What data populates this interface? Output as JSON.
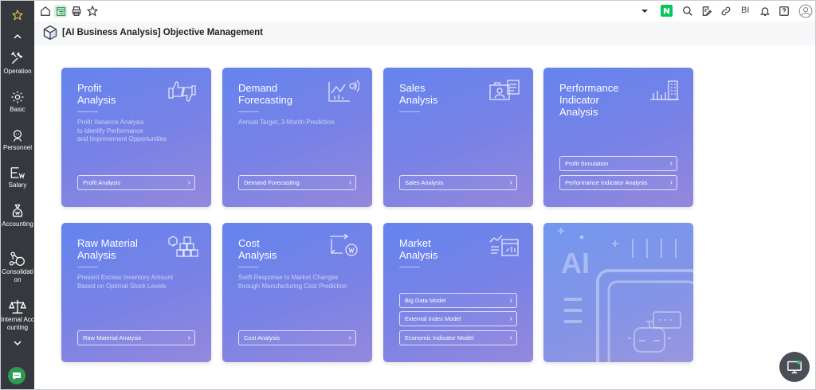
{
  "sidebar": {
    "items": [
      {
        "label": "Operation",
        "icon": "tools-icon"
      },
      {
        "label": "Basic",
        "icon": "gear-icon"
      },
      {
        "label": "Personnel",
        "icon": "person-icon"
      },
      {
        "label": "Salary",
        "icon": "salary-icon"
      },
      {
        "label": "Accounting",
        "icon": "money-bag-icon"
      },
      {
        "label": "Consolidation",
        "icon": "network-icon"
      },
      {
        "label": "Internal Accounting",
        "icon": "scale-icon"
      }
    ]
  },
  "toolbar": {
    "bi_label": "BI"
  },
  "page": {
    "title": "[AI Business Analysis] Objective Management"
  },
  "cards": {
    "profit": {
      "title": "Profit\nAnalysis",
      "desc": "Profit Variance Analysis\nto Identify Performance\nand Improvement Opportunities",
      "buttons": [
        "Profit Analysis"
      ]
    },
    "demand": {
      "title": "Demand\nForecasting",
      "desc": "Annual Target, 3-Month Prediction",
      "buttons": [
        "Demand Forecasting"
      ]
    },
    "sales": {
      "title": "Sales\nAnalysis",
      "desc": "",
      "buttons": [
        "Sales Analysis"
      ]
    },
    "performance": {
      "title": "Performance\nIndicator\nAnalysis",
      "desc": "",
      "buttons": [
        "Profit Simulation",
        "Performance Indicator Analysis"
      ]
    },
    "raw": {
      "title": "Raw Material\nAnalysis",
      "desc": "Present Excess Inventory Amount\nBased on Optimal Stock Levels",
      "buttons": [
        "Raw Material Analysis"
      ]
    },
    "cost": {
      "title": "Cost\nAnalysis",
      "desc": "Swift Response to Market Changes\nthrough Manufacturing Cost Prediction",
      "buttons": [
        "Cost Analysis"
      ]
    },
    "market": {
      "title": "Market\nAnalysis",
      "desc": "",
      "buttons": [
        "Big Data Model",
        "External Index Model",
        "Economic Indicator Model"
      ]
    },
    "ai": {
      "text": "AI"
    }
  },
  "colors": {
    "sidebar": "#35383d",
    "accent_star": "#e9c24a",
    "card_gradient_start": "#6484ee",
    "card_gradient_end": "#9488dc",
    "naver_green": "#03c75a"
  }
}
